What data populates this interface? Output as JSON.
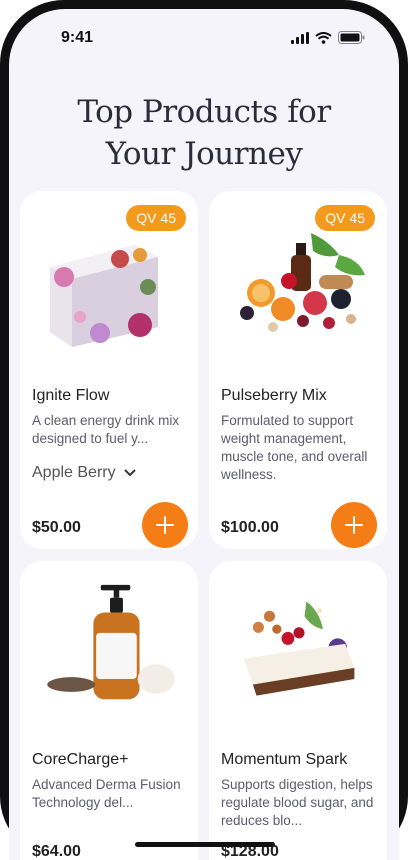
{
  "status_bar": {
    "time": "9:41",
    "icons": [
      "signal-icon",
      "wifi-icon",
      "battery-icon"
    ]
  },
  "page": {
    "title_line1": "Top Products for",
    "title_line2": "Your Journey"
  },
  "products": [
    {
      "name": "Ignite Flow",
      "description": "A clean energy drink mix designed to fuel y...",
      "badge": "QV 45",
      "variant": "Apple Berry",
      "price": "$50.00"
    },
    {
      "name": "Pulseberry Mix",
      "description": "Formulated to support weight management, muscle tone, and overall wellness.",
      "badge": "QV 45",
      "price": "$100.00"
    },
    {
      "name": "CoreCharge+",
      "description": "Advanced Derma Fusion Technology del...",
      "price": "$64.00"
    },
    {
      "name": "Momentum Spark",
      "description": "Supports digestion, helps regulate blood sugar, and reduces blo...",
      "price": "$128.00"
    }
  ],
  "colors": {
    "accent": "#f47d16",
    "badge": "#f39a1c",
    "background": "#f6f4fb"
  }
}
